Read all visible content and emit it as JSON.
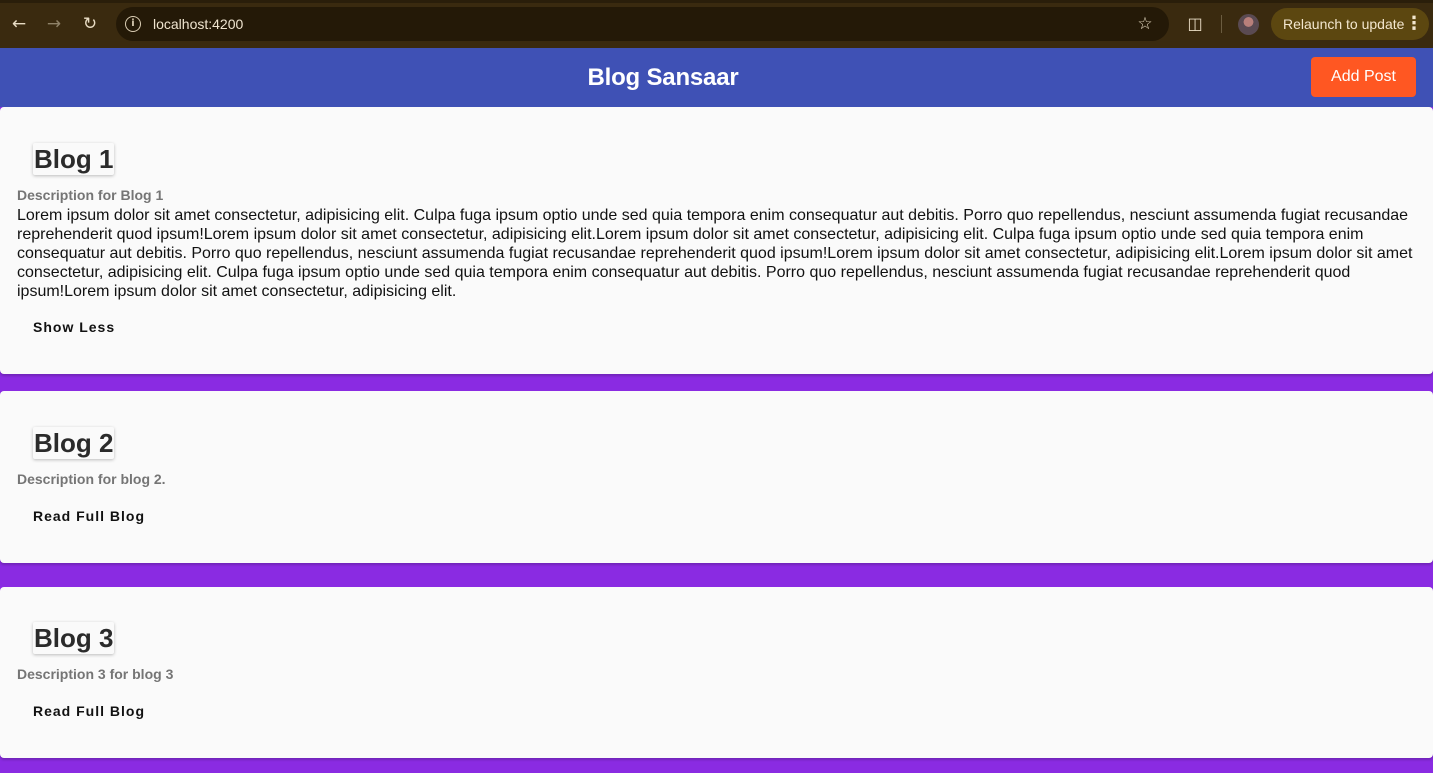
{
  "browser": {
    "url": "localhost:4200",
    "relaunch_label": "Relaunch to update",
    "icons": {
      "back": "arrow-left-icon",
      "forward": "arrow-right-icon",
      "reload": "reload-icon",
      "site_info": "info-icon",
      "bookmark": "star-icon",
      "extensions": "puzzle-icon",
      "profile": "avatar",
      "menu": "kebab-menu-icon"
    }
  },
  "app": {
    "title": "Blog Sansaar",
    "add_post_label": "Add Post",
    "colors": {
      "header": "#3f51b5",
      "add_post": "#ff5722",
      "page_background": "#8a2be2",
      "card": "#fafafa"
    }
  },
  "blogs": [
    {
      "title": "Blog 1",
      "description": "Description for Blog 1",
      "content": "Lorem ipsum dolor sit amet consectetur, adipisicing elit. Culpa fuga ipsum optio unde sed quia tempora enim consequatur aut debitis. Porro quo repellendus, nesciunt assumenda fugiat recusandae reprehenderit quod ipsum!Lorem ipsum dolor sit amet consectetur, adipisicing elit.Lorem ipsum dolor sit amet consectetur, adipisicing elit. Culpa fuga ipsum optio unde sed quia tempora enim consequatur aut debitis. Porro quo repellendus, nesciunt assumenda fugiat recusandae reprehenderit quod ipsum!Lorem ipsum dolor sit amet consectetur, adipisicing elit.Lorem ipsum dolor sit amet consectetur, adipisicing elit. Culpa fuga ipsum optio unde sed quia tempora enim consequatur aut debitis. Porro quo repellendus, nesciunt assumenda fugiat recusandae reprehenderit quod ipsum!Lorem ipsum dolor sit amet consectetur, adipisicing elit.",
      "action_label": "Show Less"
    },
    {
      "title": "Blog 2",
      "description": "Description for blog 2.",
      "action_label": "Read Full Blog"
    },
    {
      "title": "Blog 3",
      "description": "Description 3 for blog 3",
      "action_label": "Read Full Blog"
    }
  ]
}
